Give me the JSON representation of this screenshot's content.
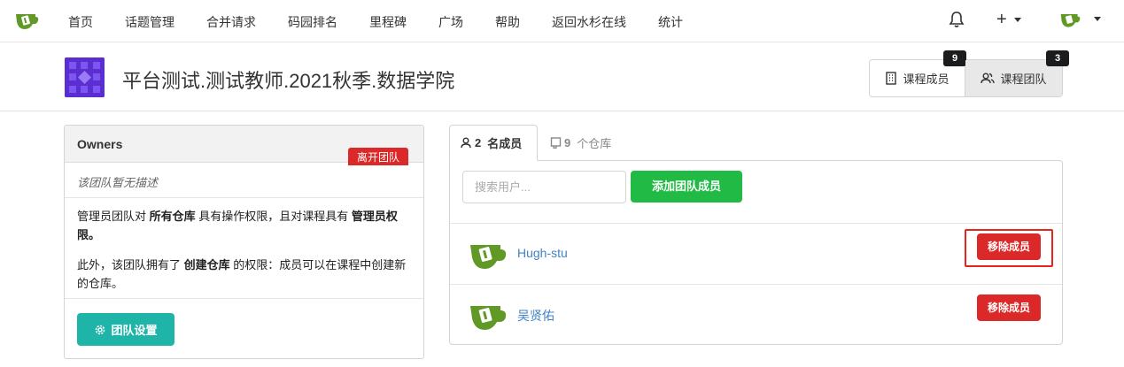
{
  "nav": {
    "items": [
      "首页",
      "话题管理",
      "合并请求",
      "码园排名",
      "里程碑",
      "广场",
      "帮助",
      "返回水杉在线",
      "统计"
    ],
    "plus_label": "+"
  },
  "header": {
    "title": "平台测试.测试教师.2021秋季.数据学院",
    "members_label": "课程成员",
    "members_count": "9",
    "teams_label": "课程团队",
    "teams_count": "3"
  },
  "team": {
    "name": "Owners",
    "leave_label": "离开团队",
    "description": "该团队暂无描述",
    "perm1_a": "管理员团队对 ",
    "perm1_b": "所有仓库",
    "perm1_c": " 具有操作权限，且对课程具有 ",
    "perm1_d": "管理员权限。",
    "perm2_a": "此外，该团队拥有了 ",
    "perm2_b": "创建仓库",
    "perm2_c": " 的权限：成员可以在课程中创建新的仓库。",
    "settings_label": "团队设置"
  },
  "tabs": {
    "members_num": "2",
    "members_label": "名成员",
    "repos_num": "9",
    "repos_label": "个仓库"
  },
  "members": {
    "search_placeholder": "搜索用户...",
    "add_label": "添加团队成员",
    "remove_label": "移除成员",
    "list": [
      {
        "name": "Hugh-stu"
      },
      {
        "name": "吴贤佑"
      }
    ]
  },
  "colors": {
    "brand": "#609926",
    "danger": "#db2828",
    "teal": "#1fb4a8",
    "green": "#21ba45",
    "highlight": "#e8231c"
  }
}
